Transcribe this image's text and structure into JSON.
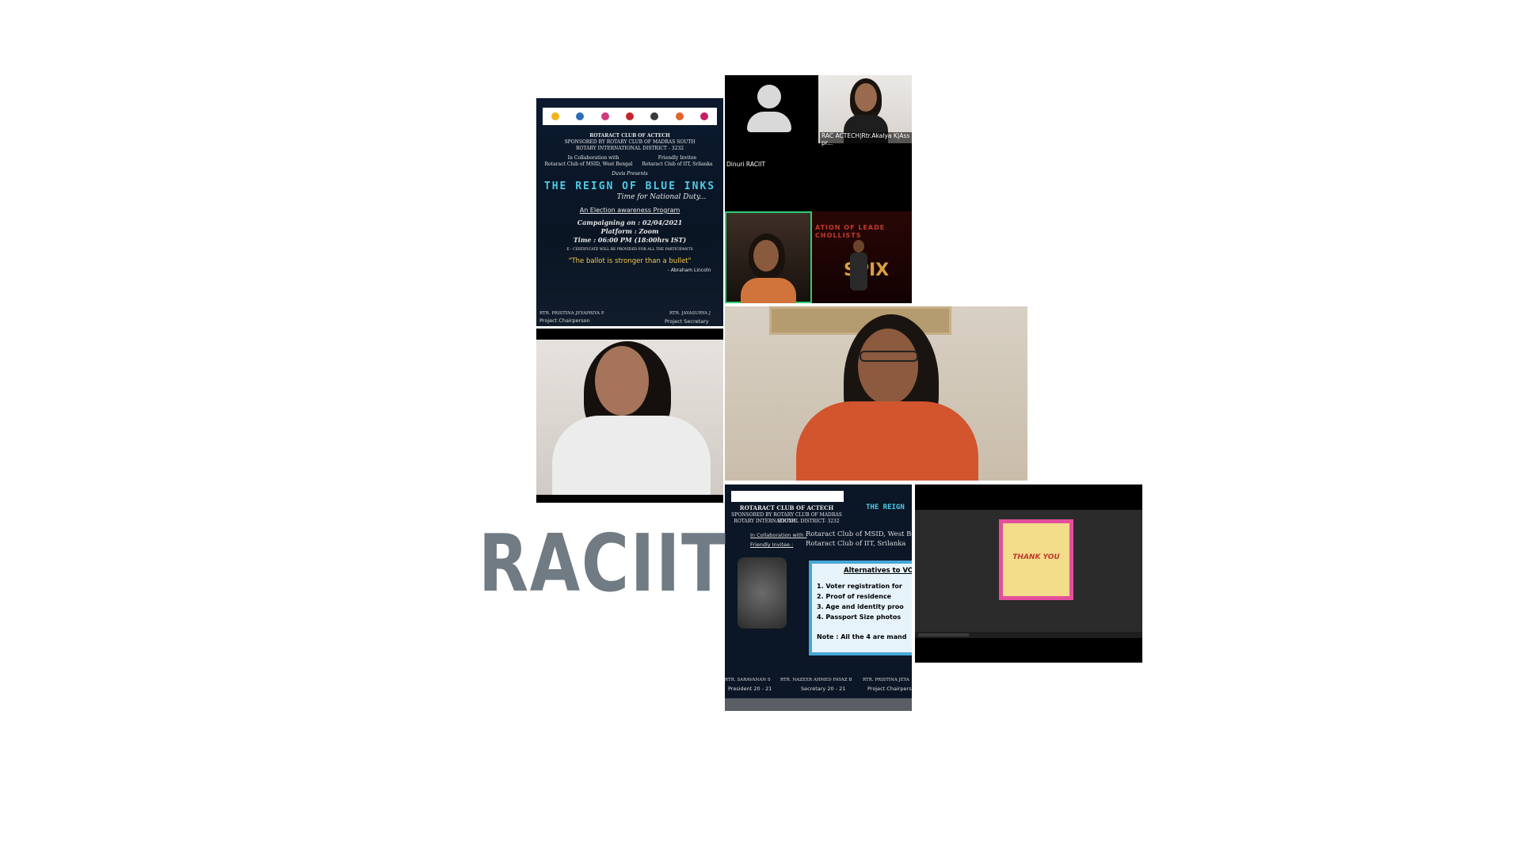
{
  "poster_top": {
    "club": "ROTARACT CLUB OF ACTECH",
    "sponsor": "SPONSORED BY ROTARY CLUB OF MADRAS SOUTH",
    "district": "ROTARY INTERNATIONAL DISTRICT - 3232",
    "collab_label": "In Collaboration with",
    "collab_club": "Rotaract Club of MSID, West Bengal",
    "invitee_label": "Friendly Invitee",
    "invitee_club": "Rotaract Club of IIT, Srilanka",
    "presents": "Duvis Presents",
    "title": "THE REIGN OF BLUE INKS",
    "subtitle": "Time for National Duty...",
    "program": "An Election awareness Program",
    "date": "Campaigning on : 02/04/2021",
    "platform": "Platform : Zoom",
    "time": "Time : 06:00 PM (18:00hrs IST)",
    "certificate": "E - CERTIFICATE WILL BE PROVIDED FOR ALL THE PARTICIPANTS",
    "quote": "\"The ballot is stronger than a bullet\"",
    "quote_author": "- Abraham Lincoln",
    "chair_name": "RTR. PRISTINA JEYAPRIYA P",
    "chair_role": "Project Chairperson",
    "secretary_name": "RTR. JAYASURYA J",
    "secretary_role": "Project Secretary"
  },
  "video_grid": {
    "participant1": "Dinuri RACIIT",
    "participant2": "RAC ACTECH|Rtr.Akalya K|Ass pr...",
    "banner_text": "ATION OF LEADE",
    "banner_text2": "CHOLLISTS",
    "banner_text3": "SPIX"
  },
  "poster_bottom": {
    "club": "ROTARACT CLUB OF ACTECH",
    "sponsor": "SPONSORED BY ROTARY CLUB OF MADRAS SOUTH",
    "district": "ROTARY INTERNATIONAL DISTRICT- 3232",
    "collab_label": "In Collaboration with :",
    "collab_club": "Rotaract Club of MSID, West Be",
    "invitee_label": "Friendly Invitee :",
    "invitee_club": "Rotaract Club of IIT, Srilanka",
    "title_fragment": "THE REIGN",
    "box_title": "Alternatives to VO",
    "items": [
      "1. Voter registration for",
      "2. Proof of residence",
      "3. Age and identity proo",
      "4. Passport Size photos"
    ],
    "note": "Note : All the 4 are mand",
    "footer": [
      {
        "name": "RTR. SARAVANAN S",
        "role": "President 20 - 21"
      },
      {
        "name": "RTR. NAZEER AHMED FAYAZ B",
        "role": "Secretary 20 - 21"
      },
      {
        "name": "RTR. PRISTINA JEYA",
        "role": "Project Chairpers"
      }
    ]
  },
  "screen_share": {
    "card_title": "THANK YOU"
  },
  "brand": {
    "label": "RACIIT"
  }
}
